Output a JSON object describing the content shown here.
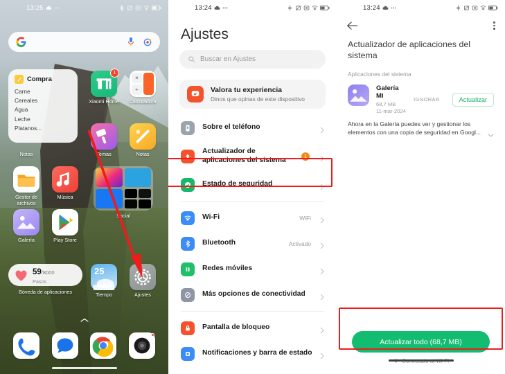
{
  "home": {
    "status": {
      "time": "13:25",
      "icons": [
        "cloud-icon",
        "dots-icon",
        "bluetooth-icon",
        "silent-icon",
        "screenshot-icon",
        "wifi-icon",
        "battery-icon"
      ]
    },
    "search": {
      "placeholder": "",
      "logo": "google-logo",
      "mic": "mic-icon",
      "lens": "google-lens-icon"
    },
    "notes_widget": {
      "title": "Compra",
      "items": [
        "Carne",
        "Cereales",
        "Agua",
        "Leche",
        "Platanos..."
      ]
    },
    "apps": [
      {
        "label": "Xiaomi Home",
        "badge": "1",
        "icon": "xiaomi-home-icon"
      },
      {
        "label": "Calculadora",
        "icon": "calculator-icon"
      },
      {
        "label": "Notas",
        "icon": "notes-icon"
      },
      {
        "label": "Temas",
        "icon": "themes-icon"
      },
      {
        "label": "Notas",
        "icon": "notes-icon"
      },
      {
        "label": "Gestor de archivos",
        "icon": "file-manager-icon"
      },
      {
        "label": "Música",
        "icon": "music-icon"
      },
      {
        "label": "Social",
        "icon": "folder-social-icon"
      },
      {
        "label": "Galería",
        "icon": "gallery-icon"
      },
      {
        "label": "Play Store",
        "icon": "play-store-icon"
      },
      {
        "label": "Tiempo",
        "icon": "weather-icon"
      },
      {
        "label": "Ajustes",
        "icon": "settings-gear-icon"
      }
    ],
    "weather_temp": "25",
    "health_widget": {
      "steps": "59",
      "goal": "/8000",
      "sub": "Pasos",
      "label": "Bóveda de aplicaciones"
    },
    "dock": [
      {
        "label": "Teléfono",
        "icon": "phone-icon"
      },
      {
        "label": "Mensajes",
        "icon": "messages-icon"
      },
      {
        "label": "Chrome",
        "icon": "chrome-icon"
      },
      {
        "label": "Cámara",
        "icon": "camera-icon"
      }
    ]
  },
  "settings": {
    "status": {
      "time": "13:24"
    },
    "title": "Ajustes",
    "search_placeholder": "Buscar en Ajustes",
    "rate_card": {
      "title": "Valora tu experiencia",
      "subtitle": "Dinos que opinas de este dispositivo",
      "icon": "feedback-icon"
    },
    "items": [
      {
        "label": "Sobre el teléfono",
        "value": "",
        "icon": "phone-info-icon",
        "color": "#9aa3ae",
        "badge": ""
      },
      {
        "label": "Actualizador de aplicaciones del sistema",
        "value": "",
        "icon": "updater-icon",
        "color": "#f4522d",
        "badge": "1",
        "highlighted": true
      },
      {
        "label": "Estado de seguridad",
        "value": "",
        "icon": "security-icon",
        "color": "#18b86b",
        "badge": ""
      },
      {
        "label": "Wi-Fi",
        "value": "WiFi",
        "icon": "wifi-icon",
        "color": "#3c8cf7",
        "badge": ""
      },
      {
        "label": "Bluetooth",
        "value": "Activado",
        "icon": "bluetooth-icon",
        "color": "#3c8cf7",
        "badge": ""
      },
      {
        "label": "Redes móviles",
        "value": "",
        "icon": "mobile-network-icon",
        "color": "#1fc069",
        "badge": ""
      },
      {
        "label": "Más opciones de conectividad",
        "value": "",
        "icon": "connectivity-icon",
        "color": "#8e95a4",
        "badge": ""
      },
      {
        "label": "Pantalla de bloqueo",
        "value": "",
        "icon": "lock-screen-icon",
        "color": "#f4522d",
        "badge": ""
      },
      {
        "label": "Notificaciones y barra de estado",
        "value": "",
        "icon": "notifications-icon",
        "color": "#3c8cf7",
        "badge": ""
      }
    ]
  },
  "updater": {
    "status": {
      "time": "13:24"
    },
    "back": "back-arrow-icon",
    "menu": "overflow-menu-icon",
    "title": "Actualizador de aplicaciones del sistema",
    "section": "Aplicaciones del sistema",
    "app": {
      "name": "Galería Mi",
      "size": "68,7 MB",
      "date": "11-mar-2024",
      "ignore_label": "IGNORAR",
      "update_label": "Actualizar",
      "description": "Ahora en la Galería puedes ver y gestionar los elementos con una copia de seguridad en Googl..."
    },
    "update_all_label": "Actualizar todo (68,7 MB)",
    "wifi_note": "Conectado al Wi-Fi"
  },
  "colors": {
    "accent_green": "#12bd71",
    "highlight_red": "#f01b1b",
    "badge_orange": "#f08a17"
  }
}
